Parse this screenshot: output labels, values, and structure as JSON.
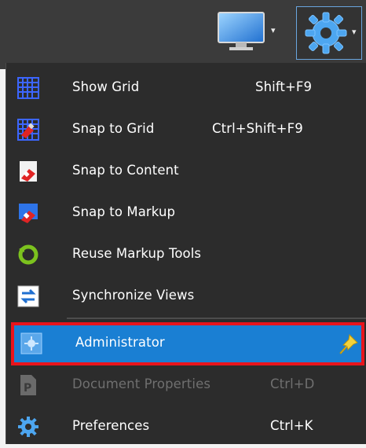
{
  "toolbar": {
    "monitor_icon": "monitor-icon",
    "gear_icon": "gear-icon"
  },
  "menu": {
    "items": [
      {
        "label": "Show Grid",
        "shortcut": "Shift+F9",
        "icon": "grid-icon"
      },
      {
        "label": "Snap to Grid",
        "shortcut": "Ctrl+Shift+F9",
        "icon": "snap-grid-icon"
      },
      {
        "label": "Snap to Content",
        "shortcut": "",
        "icon": "snap-content-icon"
      },
      {
        "label": "Snap to Markup",
        "shortcut": "",
        "icon": "snap-markup-icon"
      },
      {
        "label": "Reuse Markup Tools",
        "shortcut": "",
        "icon": "reuse-icon"
      },
      {
        "label": "Synchronize Views",
        "shortcut": "",
        "icon": "sync-icon"
      },
      {
        "label": "Administrator",
        "shortcut": "",
        "icon": "admin-icon",
        "pin_icon": "pin-icon"
      },
      {
        "label": "Document Properties",
        "shortcut": "Ctrl+D",
        "icon": "document-icon"
      },
      {
        "label": "Preferences",
        "shortcut": "Ctrl+K",
        "icon": "preferences-gear-icon"
      }
    ]
  },
  "colors": {
    "toolbar_bg": "#3b3b3b",
    "menu_bg": "#2c2c2c",
    "selection": "#1a7fd3",
    "highlight_outline": "#e8141c"
  }
}
